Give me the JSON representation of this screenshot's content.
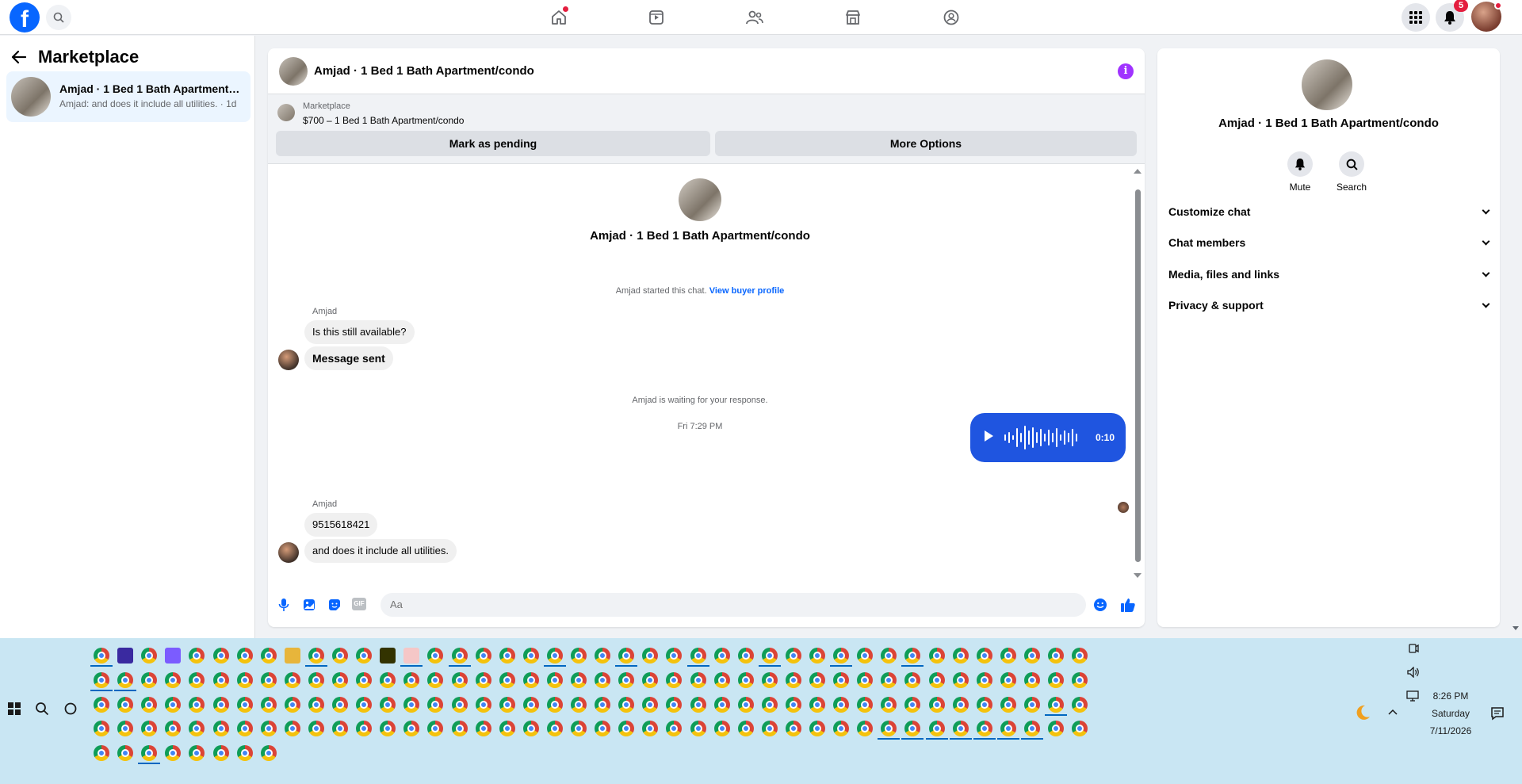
{
  "left": {
    "title": "Marketplace",
    "conversation": {
      "title": "Amjad · 1 Bed 1 Bath Apartment/c...",
      "subtitle": "Amjad: and does it include all utilities. · 1d"
    }
  },
  "nav": {
    "notification_count": "5"
  },
  "chat": {
    "header_title": "Amjad · 1 Bed 1 Bath Apartment/condo",
    "marketplace_label": "Marketplace",
    "listing": "$700 – 1 Bed 1 Bath Apartment/condo",
    "mark_pending": "Mark as pending",
    "more_options": "More Options",
    "center_title": "Amjad · 1 Bed 1 Bath Apartment/condo",
    "started_text": "Amjad started this chat.",
    "view_buyer": "View buyer profile",
    "sender1": "Amjad",
    "msg1": "Is this still available?",
    "msg2": "Message sent",
    "waiting": "Amjad is waiting for your response.",
    "timestamp": "Fri 7:29 PM",
    "voice_duration": "0:10",
    "sender2": "Amjad",
    "msg3": "9515618421",
    "msg4": "and does it include all utilities.",
    "composer_placeholder": "Aa",
    "icons": [
      "microphone-icon",
      "photo-icon",
      "sticker-icon",
      "gif-icon",
      "emoji-icon",
      "thumbs-up-icon"
    ],
    "gif_label": "GIF"
  },
  "right": {
    "title": "Amjad · 1 Bed 1 Bath Apartment/condo",
    "mute": "Mute",
    "search": "Search",
    "rows": [
      "Customize chat",
      "Chat members",
      "Media, files and links",
      "Privacy & support"
    ]
  },
  "taskbar": {
    "time": "8:26 PM",
    "day": "Saturday",
    "date": "7/11/2026"
  },
  "colors": {
    "brand": "#0866ff",
    "voice_bubble": "#1f55e0",
    "info": "#a033ff",
    "selected_conv": "#ebf5ff",
    "taskbar": "#c9e6f3"
  }
}
